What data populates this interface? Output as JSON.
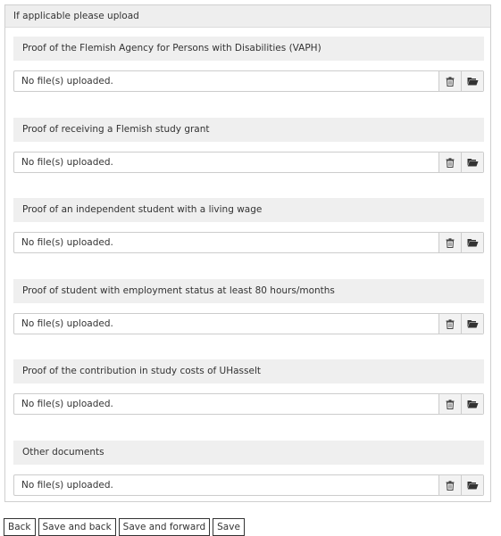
{
  "panel": {
    "title": "If applicable please upload"
  },
  "sections": [
    {
      "label": "Proof of the Flemish Agency for Persons with Disabilities (VAPH)",
      "status": "No file(s) uploaded."
    },
    {
      "label": "Proof of receiving a Flemish study grant",
      "status": "No file(s) uploaded."
    },
    {
      "label": "Proof of an independent student with a living wage",
      "status": "No file(s) uploaded."
    },
    {
      "label": "Proof of student with employment status at least 80 hours/months",
      "status": "No file(s) uploaded."
    },
    {
      "label": "Proof of the contribution in study costs of UHasselt",
      "status": "No file(s) uploaded."
    },
    {
      "label": "Other documents",
      "status": "No file(s) uploaded."
    }
  ],
  "icons": {
    "delete": "trash-icon",
    "browse": "folder-open-icon"
  },
  "buttons": {
    "back": "Back",
    "save_and_back": "Save and back",
    "save_and_forward": "Save and forward",
    "save": "Save"
  }
}
